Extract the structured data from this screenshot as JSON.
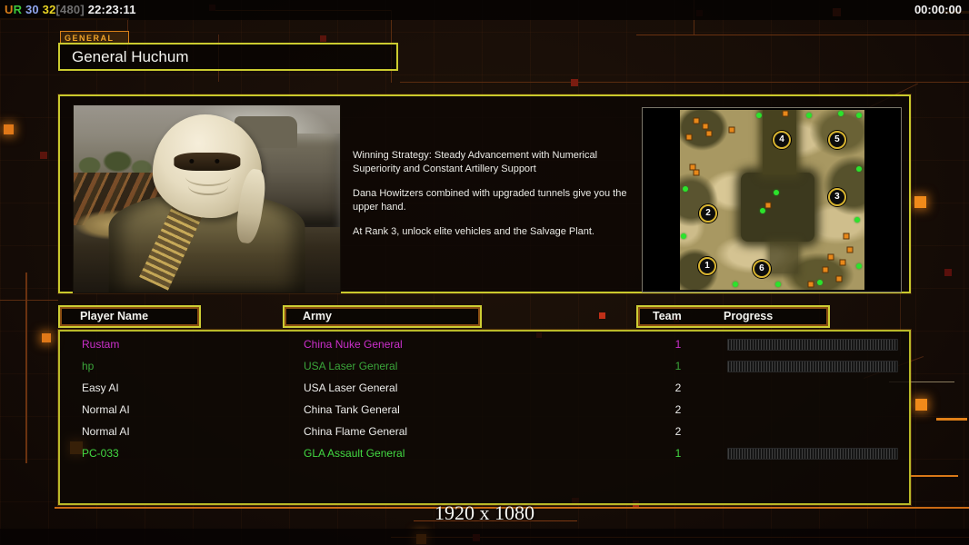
{
  "overlay": {
    "stats_tokens": [
      {
        "text": "U",
        "color": "#d87c18"
      },
      {
        "text": "R",
        "color": "#3cc83c"
      },
      {
        "text": " 30",
        "color": "#8fa6ee"
      },
      {
        "text": " 32",
        "color": "#e8d424"
      },
      {
        "text": "[480]",
        "color": "#6f6f6f"
      },
      {
        "text": " 22:23:11",
        "color": "#f2f2f2"
      }
    ],
    "match_timer": "00:00:00",
    "resolution": "1920 x 1080"
  },
  "header": {
    "tab_label": "GENERAL",
    "general_name": "General Huchum"
  },
  "info": {
    "strategy_lines": [
      "Winning Strategy: Steady Advancement with Numerical Superiority and Constant Artillery Support",
      "Dana Howitzers combined with upgraded tunnels give you the upper hand.",
      "At Rank 3, unlock elite vehicles and the Salvage Plant."
    ],
    "map_markers": [
      {
        "label": "1",
        "x": 14.8,
        "y": 86.9
      },
      {
        "label": "2",
        "x": 15.3,
        "y": 57.6
      },
      {
        "label": "3",
        "x": 85.2,
        "y": 48.5
      },
      {
        "label": "4",
        "x": 55.2,
        "y": 16.7
      },
      {
        "label": "5",
        "x": 85.2,
        "y": 16.7
      },
      {
        "label": "6",
        "x": 44.3,
        "y": 88.4
      }
    ]
  },
  "table": {
    "headers": {
      "player": "Player Name",
      "army": "Army",
      "team": "Team",
      "progress": "Progress"
    },
    "rows": [
      {
        "player": "Rustam",
        "army": "China Nuke General",
        "team": "1",
        "color": "#cc2fcc",
        "has_progress": true
      },
      {
        "player": "hp",
        "army": "USA Laser General",
        "team": "1",
        "color": "#3aa53a",
        "has_progress": true
      },
      {
        "player": "Easy AI",
        "army": "USA Laser General",
        "team": "2",
        "color": "#ececea",
        "has_progress": false
      },
      {
        "player": "Normal AI",
        "army": "China Tank General",
        "team": "2",
        "color": "#ececea",
        "has_progress": false
      },
      {
        "player": "Normal AI",
        "army": "China Flame General",
        "team": "2",
        "color": "#ececea",
        "has_progress": false
      },
      {
        "player": "PC-033",
        "army": "GLA Assault General",
        "team": "1",
        "color": "#42d942",
        "has_progress": true
      }
    ]
  },
  "colors": {
    "panel_border": "#cbcb2f",
    "accent_orange": "#d87818",
    "magenta": "#cc2fcc",
    "green_dim": "#3aa53a",
    "green_bright": "#42d942"
  }
}
